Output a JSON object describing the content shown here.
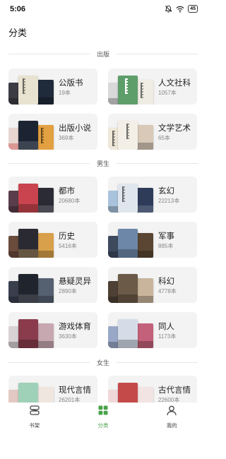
{
  "status_bar": {
    "time": "5:06",
    "battery": "45"
  },
  "page": {
    "title": "分类"
  },
  "sections": [
    {
      "label": "出版",
      "items": [
        {
          "title": "公版书",
          "count": "19本",
          "covers": [
            "#3c3c44",
            "#e8e2d0",
            "#1f2a3a"
          ]
        },
        {
          "title": "人文社科",
          "count": "1057本",
          "covers": [
            "#d9d9d9",
            "#5d9e6b",
            "#efece4"
          ]
        },
        {
          "title": "出版小说",
          "count": "369本",
          "covers": [
            "#e8d6d0",
            "#1c2433",
            "#e3a040"
          ]
        },
        {
          "title": "文学艺术",
          "count": "65本",
          "covers": [
            "#efe8da",
            "#f3efe7",
            "#d8c9b8"
          ]
        }
      ]
    },
    {
      "label": "男生",
      "items": [
        {
          "title": "都市",
          "count": "20680本",
          "covers": [
            "#5a3d4a",
            "#c9444e",
            "#2b2b35"
          ]
        },
        {
          "title": "玄幻",
          "count": "22213本",
          "covers": [
            "#a9c3dd",
            "#dfe6ee",
            "#2e3c5a"
          ]
        },
        {
          "title": "历史",
          "count": "5416本",
          "covers": [
            "#6b4b3b",
            "#2a2a33",
            "#d8a04a"
          ]
        },
        {
          "title": "军事",
          "count": "885本",
          "covers": [
            "#3d4a5e",
            "#6d87a8",
            "#5a4632"
          ]
        },
        {
          "title": "悬疑灵异",
          "count": "2890本",
          "covers": [
            "#3a3f4e",
            "#20242d",
            "#556070"
          ]
        },
        {
          "title": "科幻",
          "count": "4778本",
          "covers": [
            "#4e4034",
            "#6b5a47",
            "#c8b59c"
          ]
        },
        {
          "title": "游戏体育",
          "count": "3630本",
          "covers": [
            "#d9d2d5",
            "#8a3c4c",
            "#c7a7b0"
          ]
        },
        {
          "title": "同人",
          "count": "1173本",
          "covers": [
            "#9aa8c8",
            "#d5dce8",
            "#c3617a"
          ]
        }
      ]
    },
    {
      "label": "女生",
      "items": [
        {
          "title": "现代言情",
          "count": "26201本",
          "covers": [
            "#e3c9c3",
            "#9fd0b8",
            "#f0e6e0"
          ]
        },
        {
          "title": "古代言情",
          "count": "22600本",
          "covers": [
            "#f0d8d8",
            "#c44a4a",
            "#f1e4e2"
          ]
        }
      ]
    }
  ],
  "tabs": [
    {
      "label": "书架",
      "icon": "bookshelf-icon",
      "active": false
    },
    {
      "label": "分类",
      "icon": "category-icon",
      "active": true
    },
    {
      "label": "我的",
      "icon": "profile-icon",
      "active": false
    }
  ],
  "colors": {
    "accent": "#4aa34a",
    "card_bg": "#f3f3f3",
    "divider": "#e6e6e6"
  }
}
